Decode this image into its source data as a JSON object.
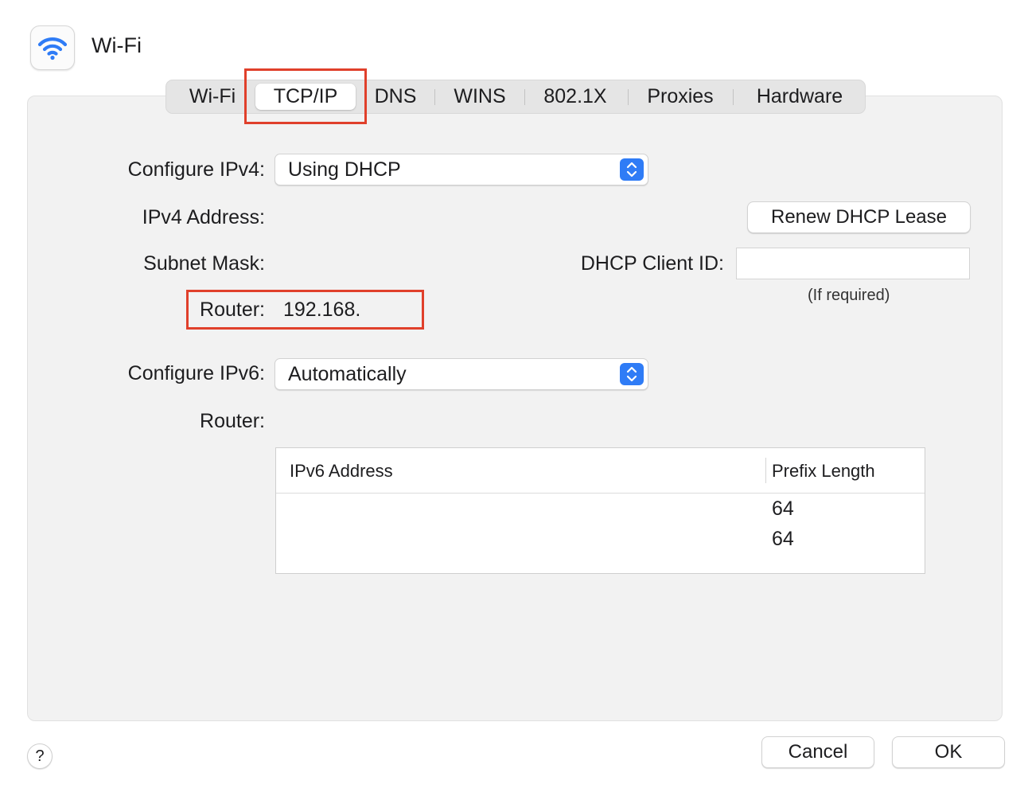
{
  "window": {
    "title": "Wi-Fi",
    "icon": "wifi-icon"
  },
  "tabs": [
    {
      "label": "Wi-Fi"
    },
    {
      "label": "TCP/IP",
      "selected": true
    },
    {
      "label": "DNS"
    },
    {
      "label": "WINS"
    },
    {
      "label": "802.1X"
    },
    {
      "label": "Proxies"
    },
    {
      "label": "Hardware"
    }
  ],
  "ipv4": {
    "configure_label": "Configure IPv4:",
    "configure_value": "Using DHCP",
    "address_label": "IPv4 Address:",
    "address_value": "",
    "subnet_label": "Subnet Mask:",
    "subnet_value": "",
    "router_label": "Router:",
    "router_value": "192.168."
  },
  "dhcp": {
    "renew_button": "Renew DHCP Lease",
    "client_id_label": "DHCP Client ID:",
    "client_id_value": "",
    "client_id_hint": "(If required)"
  },
  "ipv6": {
    "configure_label": "Configure IPv6:",
    "configure_value": "Automatically",
    "router_label": "Router:",
    "router_value": "",
    "table": {
      "columns": [
        "IPv6 Address",
        "Prefix Length"
      ],
      "rows": [
        {
          "address": "",
          "prefix": "64"
        },
        {
          "address": "",
          "prefix": "64"
        }
      ]
    }
  },
  "footer": {
    "help_label": "?",
    "cancel_label": "Cancel",
    "ok_label": "OK"
  },
  "colors": {
    "accent": "#2f7cf6",
    "highlight": "#e0402b",
    "wifi": "#2f7cf6"
  }
}
